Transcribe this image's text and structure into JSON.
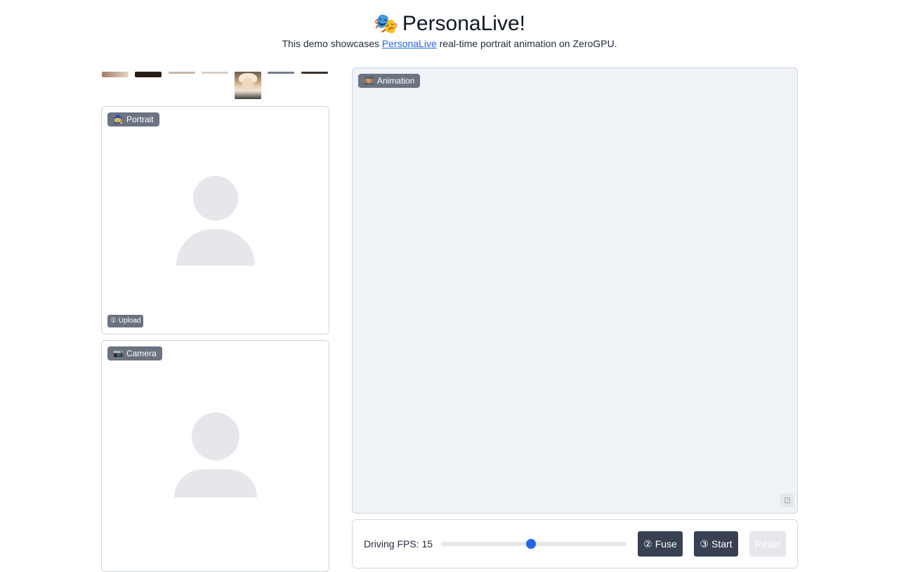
{
  "header": {
    "title_emoji": "🎭",
    "title": "PersonaLive!",
    "subtitle_prefix": "This demo showcases ",
    "subtitle_link": "PersonaLive",
    "subtitle_suffix": " real-time portrait animation on ZeroGPU."
  },
  "examples": {
    "count": 7,
    "selected_index": 4
  },
  "portrait_panel": {
    "label": "Portrait",
    "icon": "🧙",
    "upload_label": "Upload",
    "upload_icon": "①"
  },
  "camera_panel": {
    "label": "Camera",
    "icon": "📷"
  },
  "animation_panel": {
    "label": "Animation",
    "icon": "🎞️"
  },
  "controls": {
    "fps_label": "Driving FPS: 15",
    "fps_value": 15,
    "fps_fraction": 0.485,
    "fuse_label": "Fuse",
    "fuse_icon": "②",
    "start_label": "Start",
    "start_icon": "③",
    "reset_label": "Reset"
  },
  "colors": {
    "accent": "#2563eb",
    "badge": "#6b7280",
    "button_dark": "#374151",
    "animation_bg": "#eff3f8"
  }
}
